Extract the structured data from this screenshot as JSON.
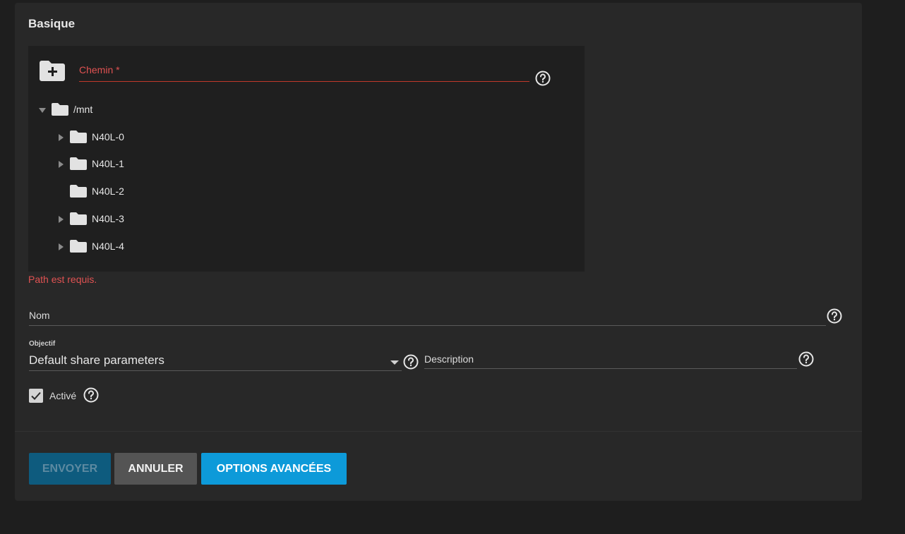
{
  "section": {
    "title": "Basique"
  },
  "explorer": {
    "path_label": "Chemin *",
    "icons": {
      "add_folder": "folder-plus-icon",
      "help": "help-circle-icon",
      "folder": "folder-icon",
      "caret": "caret-icon"
    },
    "root": {
      "label": "/mnt",
      "expanded": true
    },
    "items": [
      {
        "label": "N40L-0",
        "has_children": true
      },
      {
        "label": "N40L-1",
        "has_children": true
      },
      {
        "label": "N40L-2",
        "has_children": false
      },
      {
        "label": "N40L-3",
        "has_children": true
      },
      {
        "label": "N40L-4",
        "has_children": true
      }
    ]
  },
  "error": {
    "path_required": "Path est requis."
  },
  "fields": {
    "name": {
      "label": "Nom"
    },
    "purpose": {
      "label": "Objectif",
      "value": "Default share parameters"
    },
    "description": {
      "label": "Description"
    },
    "enabled": {
      "label": "Activé",
      "checked": true
    }
  },
  "buttons": {
    "submit": "ENVOYER",
    "cancel": "ANNULER",
    "advanced": "OPTIONS AVANCÉES"
  },
  "colors": {
    "background": "#1e1e1e",
    "card": "#282828",
    "error": "#e05252",
    "primary": "#0d9ad9",
    "submit_disabled": "#0e5b7e"
  }
}
